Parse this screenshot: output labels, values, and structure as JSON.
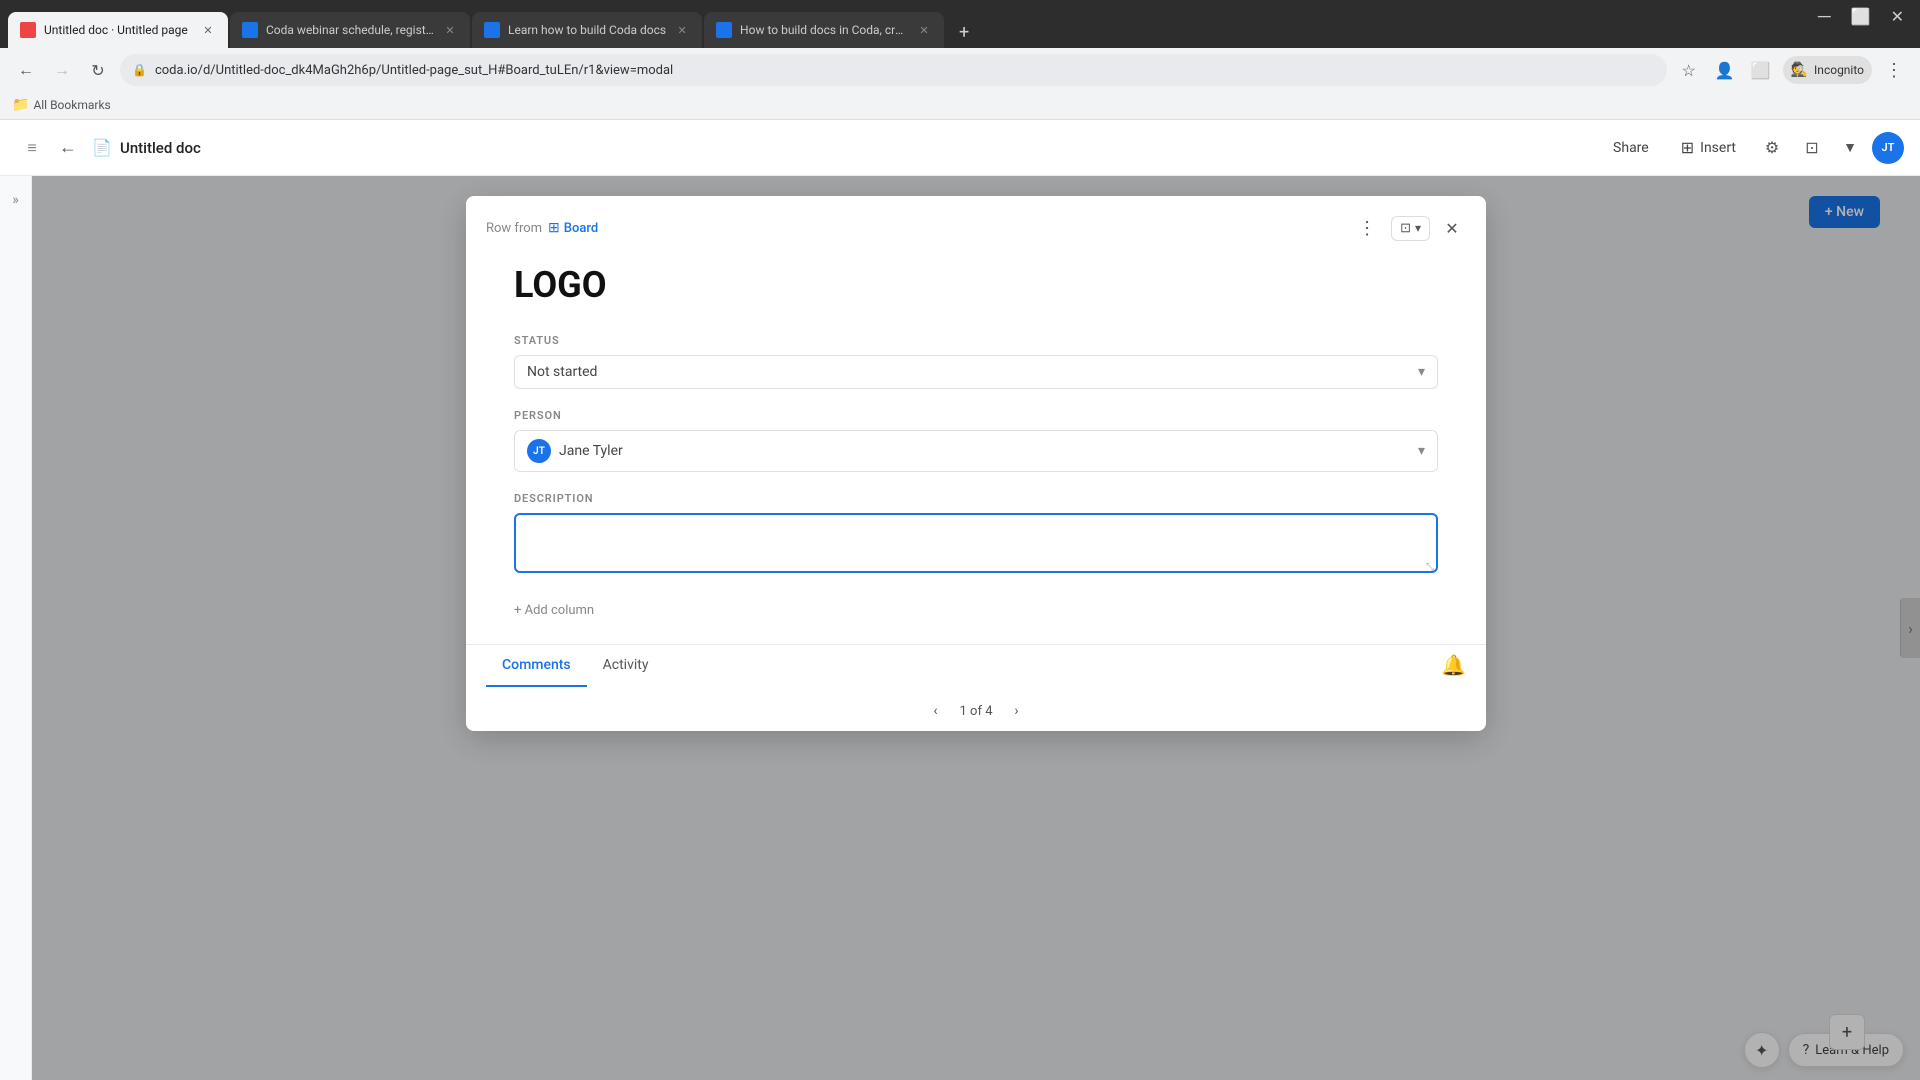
{
  "browser": {
    "tabs": [
      {
        "id": "tab1",
        "favicon_color": "#ef4444",
        "title": "Untitled doc · Untitled page",
        "active": true
      },
      {
        "id": "tab2",
        "favicon_color": "#1a73e8",
        "title": "Coda webinar schedule, regist...",
        "active": false
      },
      {
        "id": "tab3",
        "favicon_color": "#1a73e8",
        "title": "Learn how to build Coda docs",
        "active": false
      },
      {
        "id": "tab4",
        "favicon_color": "#1a73e8",
        "title": "How to build docs in Coda, cre...",
        "active": false
      }
    ],
    "url": "coda.io/d/Untitled-doc_dk4MaGh2h6p/Untitled-page_sut_H#Board_tuLEn/r1&view=modal",
    "incognito_label": "Incognito",
    "bookmarks_label": "All Bookmarks"
  },
  "app_header": {
    "doc_title": "Untitled doc",
    "share_label": "Share",
    "insert_label": "Insert",
    "user_initials": "JT"
  },
  "modal": {
    "row_from_label": "Row from",
    "board_label": "Board",
    "title": "LOGO",
    "status_field": {
      "label": "STATUS",
      "value": "Not started"
    },
    "person_field": {
      "label": "PERSON",
      "value": "Jane Tyler",
      "initials": "JT"
    },
    "description_field": {
      "label": "DESCRIPTION",
      "placeholder": ""
    },
    "add_column_label": "+ Add column",
    "tabs": [
      {
        "id": "comments",
        "label": "Comments",
        "active": true
      },
      {
        "id": "activity",
        "label": "Activity",
        "active": false
      }
    ],
    "pagination": {
      "current": 1,
      "total": 4,
      "display": "1 of 4"
    }
  },
  "new_button_label": "+ New",
  "bottom_bar": {
    "learn_help_label": "Learn & Help"
  }
}
